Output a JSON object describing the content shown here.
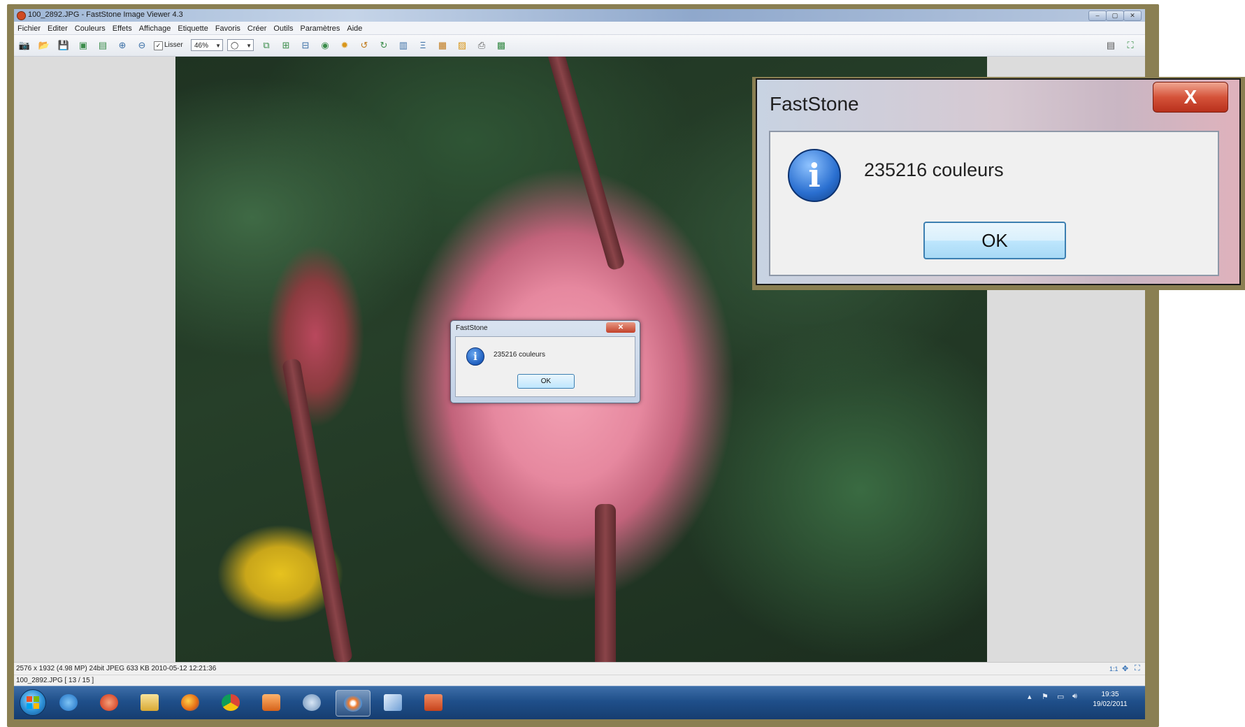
{
  "window": {
    "title": "100_2892.JPG  -  FastStone Image Viewer 4.3",
    "controls": [
      "–",
      "▢",
      "✕"
    ]
  },
  "menu": {
    "items": [
      "Fichier",
      "Editer",
      "Couleurs",
      "Effets",
      "Affichage",
      "Etiquette",
      "Favoris",
      "Créer",
      "Outils",
      "Paramètres",
      "Aide"
    ]
  },
  "toolbar": {
    "smooth_label": "Lisser",
    "smooth_checked": "✓",
    "zoom_value": "46%",
    "shape_value": "◯"
  },
  "dialog_small": {
    "title": "FastStone",
    "close": "✕",
    "icon": "i",
    "message": "235216 couleurs",
    "ok": "OK"
  },
  "status": {
    "info": "2576 x 1932 (4.98 MP)   24bit JPEG   633 KB   2010-05-12 12:21:36",
    "ratio": "1:1",
    "file": "100_2892.JPG [ 13 / 15 ]"
  },
  "taskbar": {
    "time": "19:35",
    "date": "19/02/2011"
  },
  "dialog_zoom": {
    "title": "FastStone",
    "close": "X",
    "icon": "i",
    "message": "235216 couleurs",
    "ok": "OK"
  }
}
